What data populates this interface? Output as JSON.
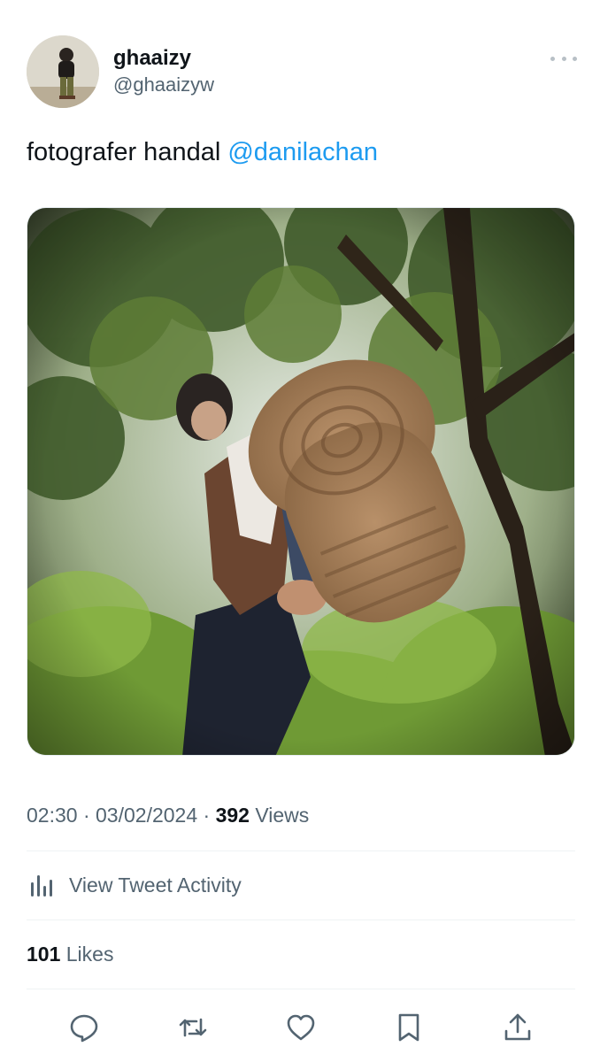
{
  "author": {
    "display_name": "ghaaizy",
    "handle": "@ghaaizyw",
    "avatar_icon": "profile-photo"
  },
  "tweet": {
    "text": "fotografer handal ",
    "mention": "@danilachan",
    "media_icon": "photo"
  },
  "meta": {
    "time": "02:30",
    "separator1": " · ",
    "date": "03/02/2024",
    "separator2": " · ",
    "views_count": "392",
    "views_label": " Views"
  },
  "activity": {
    "label": "View Tweet Activity",
    "icon": "bar-chart-icon"
  },
  "likes": {
    "count": "101",
    "label": " Likes"
  },
  "actions": {
    "reply": "reply-icon",
    "retweet": "retweet-icon",
    "like": "heart-icon",
    "bookmark": "bookmark-icon",
    "share": "share-icon"
  },
  "colors": {
    "text": "#0f1419",
    "secondary": "#536471",
    "accent": "#1d9bf0",
    "divider": "#eff3f4"
  }
}
